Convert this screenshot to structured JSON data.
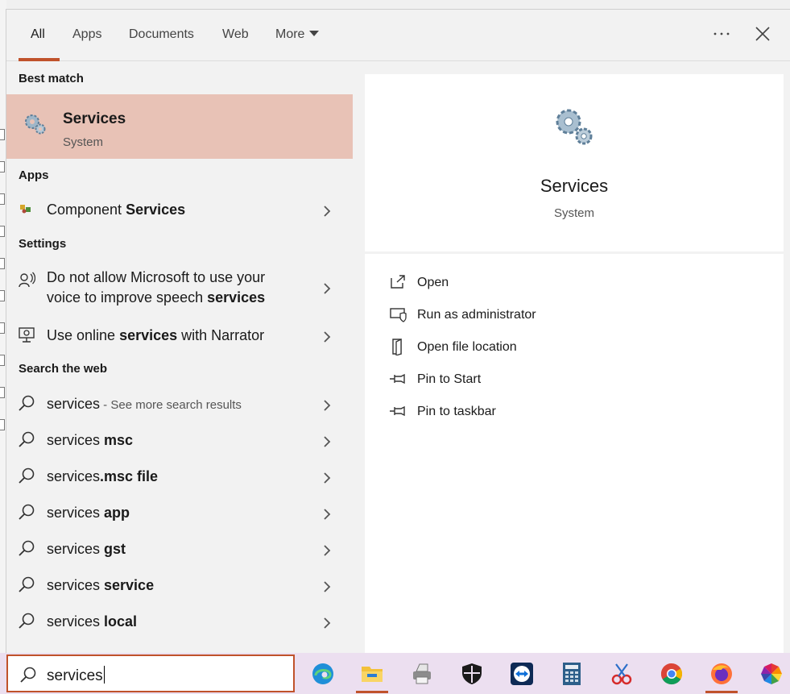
{
  "tabs": [
    {
      "label": "All",
      "active": true
    },
    {
      "label": "Apps"
    },
    {
      "label": "Documents"
    },
    {
      "label": "Web"
    },
    {
      "label": "More"
    }
  ],
  "sections": {
    "best_match": "Best match",
    "apps": "Apps",
    "settings": "Settings",
    "web": "Search the web"
  },
  "best_match": {
    "title": "Services",
    "subtitle": "System"
  },
  "apps": [
    {
      "prefix": "Component ",
      "bold": "Services",
      "suffix": ""
    }
  ],
  "settings": [
    {
      "line1": "Do not allow Microsoft to use your",
      "line2_prefix": "voice to improve speech ",
      "line2_bold": "services"
    },
    {
      "prefix": "Use online ",
      "bold": "services",
      "suffix": " with Narrator"
    }
  ],
  "web": [
    {
      "prefix": "services",
      "bold": "",
      "sub": " - See more search results"
    },
    {
      "prefix": "services ",
      "bold": "msc"
    },
    {
      "prefix": "services",
      "bold": ".msc file"
    },
    {
      "prefix": "services ",
      "bold": "app"
    },
    {
      "prefix": "services ",
      "bold": "gst"
    },
    {
      "prefix": "services ",
      "bold": "service"
    },
    {
      "prefix": "services ",
      "bold": "local"
    }
  ],
  "detail": {
    "title": "Services",
    "subtitle": "System"
  },
  "actions": [
    {
      "label": "Open",
      "icon": "open-icon"
    },
    {
      "label": "Run as administrator",
      "icon": "shield-icon"
    },
    {
      "label": "Open file location",
      "icon": "folder-icon"
    },
    {
      "label": "Pin to Start",
      "icon": "pin-icon"
    },
    {
      "label": "Pin to taskbar",
      "icon": "pin-icon"
    }
  ],
  "search": {
    "value": "services"
  },
  "taskbar_apps": [
    "edge-icon",
    "file-explorer-icon",
    "printer-icon",
    "security-icon",
    "teamviewer-icon",
    "calculator-icon",
    "snipping-icon",
    "chrome-icon",
    "firefox-icon",
    "photos-icon"
  ],
  "colors": {
    "accent": "#c0522b",
    "highlight": "#e8c2b6",
    "taskbar": "#ecdff0"
  }
}
